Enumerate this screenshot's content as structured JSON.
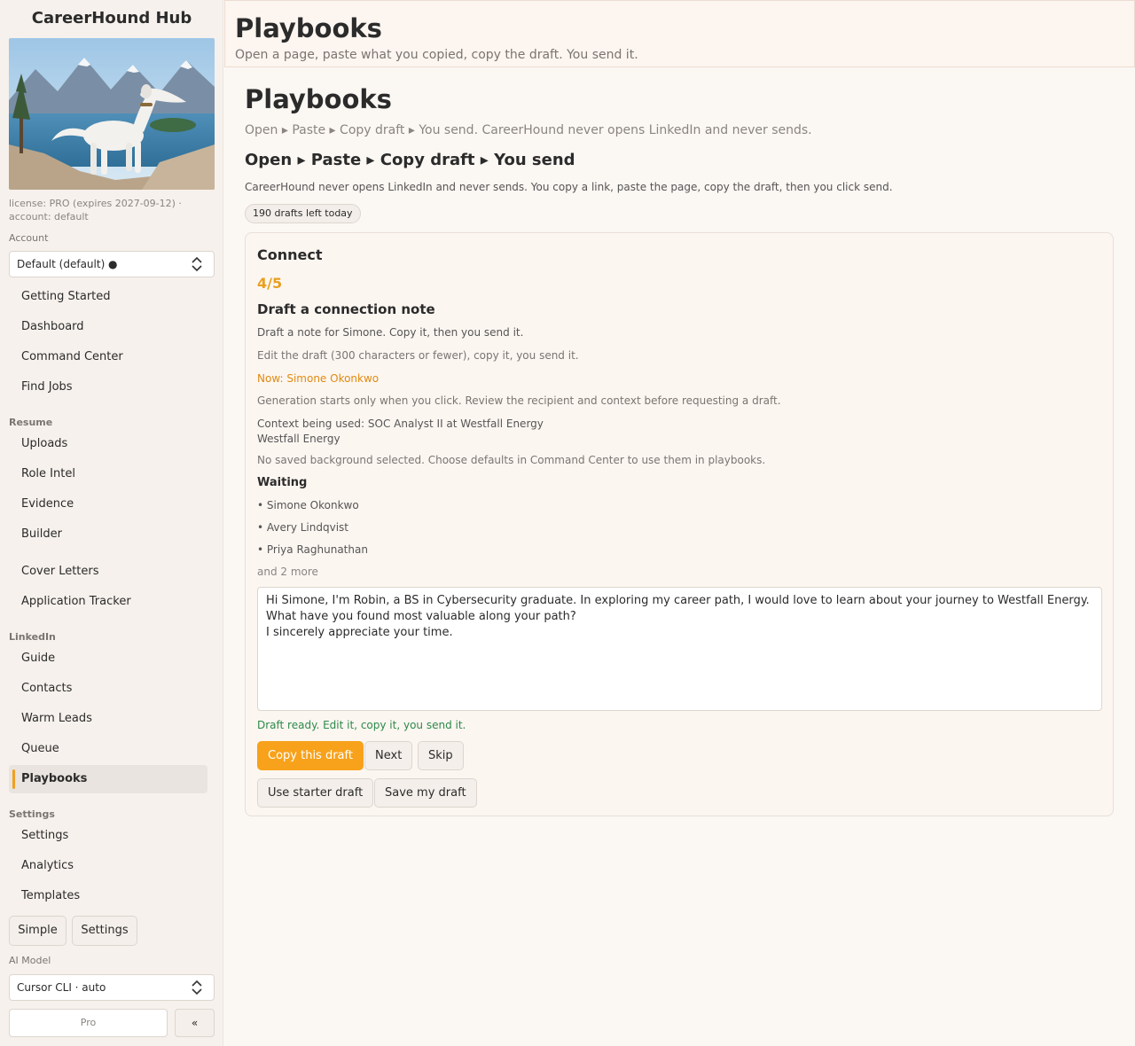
{
  "sidebar": {
    "brand": "CareerHound Hub",
    "license": "license: PRO (expires 2027-09-12) · account: default",
    "account_label": "Account",
    "account_value": "Default (default) ●",
    "nav_top": [
      {
        "label": "Getting Started"
      },
      {
        "label": "Dashboard"
      },
      {
        "label": "Command Center"
      },
      {
        "label": "Find Jobs"
      }
    ],
    "resume_label": "Resume",
    "nav_resume": [
      {
        "label": "Uploads"
      },
      {
        "label": "Role Intel"
      },
      {
        "label": "Evidence"
      },
      {
        "label": "Builder"
      },
      {
        "label": "Cover Letters"
      },
      {
        "label": "Application Tracker"
      }
    ],
    "linkedin_label": "LinkedIn",
    "nav_linkedin": [
      {
        "label": "Guide"
      },
      {
        "label": "Contacts"
      },
      {
        "label": "Warm Leads"
      },
      {
        "label": "Queue"
      },
      {
        "label": "Playbooks"
      }
    ],
    "settings_label": "Settings",
    "nav_settings": [
      {
        "label": "Settings"
      },
      {
        "label": "Analytics"
      },
      {
        "label": "Templates"
      }
    ],
    "simple_button": "Simple",
    "settings_button": "Settings",
    "ai_model_label": "AI Model",
    "ai_model_value": "Cursor CLI · auto",
    "pro_label": "Pro",
    "collapse_label": "«"
  },
  "header": {
    "title": "Playbooks",
    "subtitle": "Open a page, paste what you copied, copy the draft. You send it."
  },
  "main": {
    "title": "Playbooks",
    "flow_line": "Open ▸ Paste ▸ Copy draft ▸ You send. CareerHound never opens LinkedIn and never sends.",
    "flow_heading": "Open ▸ Paste ▸ Copy draft ▸ You send",
    "flow_note": "CareerHound never opens LinkedIn and never sends. You copy a link, paste the page, copy the draft, then you click send.",
    "badge": "190 drafts left today"
  },
  "card": {
    "title": "Connect",
    "step": "4/5",
    "heading": "Draft a connection note",
    "text1": "Draft a note for Simone. Copy it, then you send it.",
    "text2": "Edit the draft (300 characters or fewer), copy it, you send it.",
    "now": "Now: Simone Okonkwo",
    "generation": "Generation starts only when you click. Review the recipient and context before requesting a draft.",
    "context_line1": "Context being used: SOC Analyst II at Westfall Energy",
    "context_line2": "Westfall Energy",
    "no_background": "No saved background selected. Choose defaults in Command Center to use them in playbooks.",
    "waiting_label": "Waiting",
    "waiting": [
      {
        "name": "• Simone Okonkwo"
      },
      {
        "name": "• Avery Lindqvist"
      },
      {
        "name": "• Priya Raghunathan"
      }
    ],
    "more": "and 2 more",
    "draft": "Hi Simone, I'm Robin, a BS in Cybersecurity graduate. In exploring my career path, I would love to learn about your journey to Westfall Energy. What have you found most valuable along your path?\nI sincerely appreciate your time.",
    "ready": "Draft ready. Edit it, copy it, you send it.",
    "btn_copy": "Copy this draft",
    "btn_next": "Next",
    "btn_skip": "Skip",
    "btn_starter": "Use starter draft",
    "btn_save": "Save my draft"
  },
  "colors": {
    "accent": "#f7a21a",
    "success": "#2c8a4a",
    "now": "#e08a10"
  }
}
